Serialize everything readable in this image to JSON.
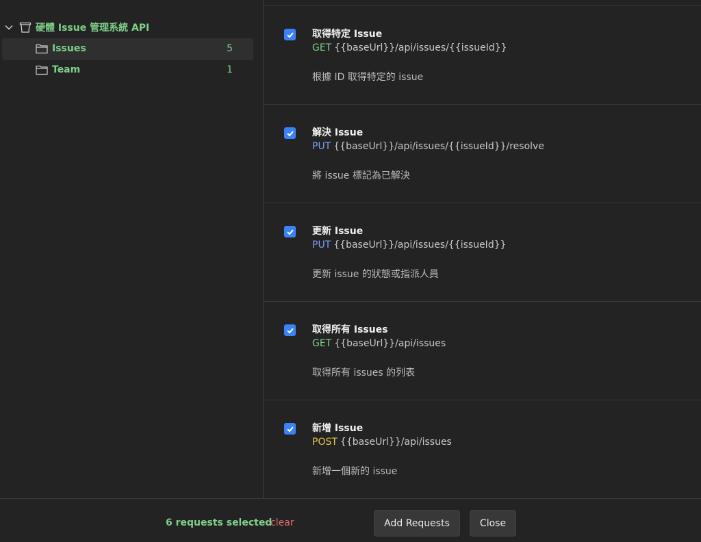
{
  "sidebar": {
    "collection": {
      "name": "硬體 Issue 管理系統 API",
      "icon": "collection-icon"
    },
    "folders": [
      {
        "name": "Issues",
        "count": "5",
        "icon": "folder-icon"
      },
      {
        "name": "Team",
        "count": "1",
        "icon": "folder-icon"
      }
    ]
  },
  "requests": [
    {
      "title": "取得特定 Issue",
      "method": "GET",
      "url": "{{baseUrl}}/api/issues/{{issueId}}",
      "description": "根據 ID 取得特定的 issue",
      "checked": true
    },
    {
      "title": "解決 Issue",
      "method": "PUT",
      "url": "{{baseUrl}}/api/issues/{{issueId}}/resolve",
      "description": "將 issue 標記為已解決",
      "checked": true
    },
    {
      "title": "更新 Issue",
      "method": "PUT",
      "url": "{{baseUrl}}/api/issues/{{issueId}}",
      "description": "更新 issue 的狀態或指派人員",
      "checked": true
    },
    {
      "title": "取得所有 Issues",
      "method": "GET",
      "url": "{{baseUrl}}/api/issues",
      "description": "取得所有 issues 的列表",
      "checked": true
    },
    {
      "title": "新增 Issue",
      "method": "POST",
      "url": "{{baseUrl}}/api/issues",
      "description": "新增一個新的 issue",
      "checked": true
    }
  ],
  "footer": {
    "selected_text": "6 requests selected",
    "separator": "·",
    "clear_label": "clear",
    "add_label": "Add Requests",
    "close_label": "Close"
  },
  "colors": {
    "accent_green": "#7ed08a",
    "checkbox_blue": "#3b82f6",
    "method_put": "#7f9cf5",
    "method_post": "#e6c84a",
    "clear_red": "#e06b6b"
  }
}
